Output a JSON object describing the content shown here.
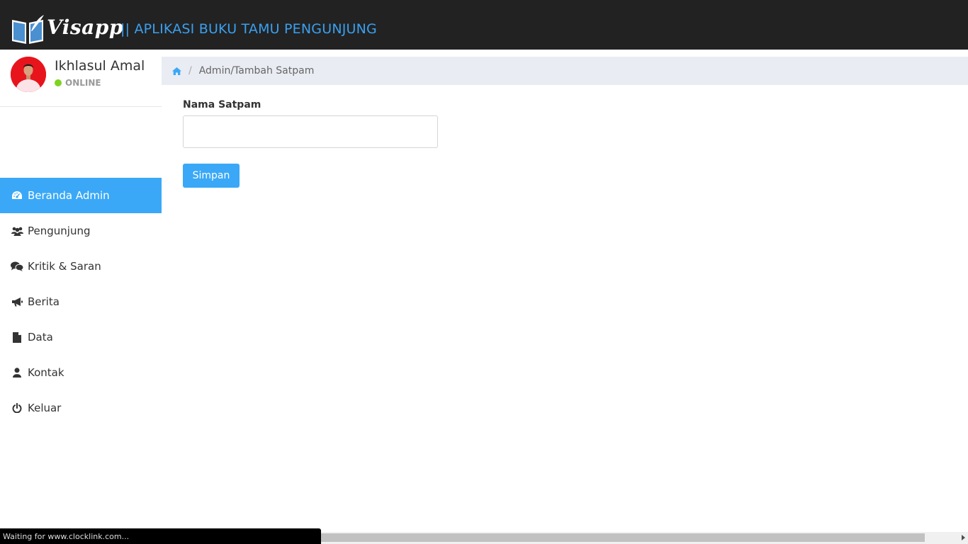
{
  "header": {
    "logo_text": "Visapp",
    "app_title": "|| APLIKASI BUKU TAMU PENGUNJUNG"
  },
  "user": {
    "name": "Ikhlasul Amal",
    "status": "ONLINE"
  },
  "sidebar": {
    "items": [
      {
        "label": "Beranda Admin",
        "icon": "dashboard-icon",
        "active": true
      },
      {
        "label": "Pengunjung",
        "icon": "users-icon",
        "active": false
      },
      {
        "label": "Kritik & Saran",
        "icon": "comments-icon",
        "active": false
      },
      {
        "label": "Berita",
        "icon": "bullhorn-icon",
        "active": false
      },
      {
        "label": "Data",
        "icon": "file-icon",
        "active": false
      },
      {
        "label": "Kontak",
        "icon": "user-icon",
        "active": false
      },
      {
        "label": "Keluar",
        "icon": "power-icon",
        "active": false
      }
    ]
  },
  "breadcrumb": {
    "home_icon": "home-icon",
    "separator": "/",
    "path": "Admin/Tambah Satpam"
  },
  "form": {
    "label": "Nama Satpam",
    "value": "",
    "placeholder": "",
    "submit_label": "Simpan"
  },
  "browser": {
    "status_text": "Waiting for www.clocklink.com..."
  },
  "colors": {
    "header_bg": "#222222",
    "accent": "#3aa8f7",
    "title_color": "#3aa0f0",
    "breadcrumb_bg": "#e9ecf3",
    "online": "#7ed321"
  }
}
